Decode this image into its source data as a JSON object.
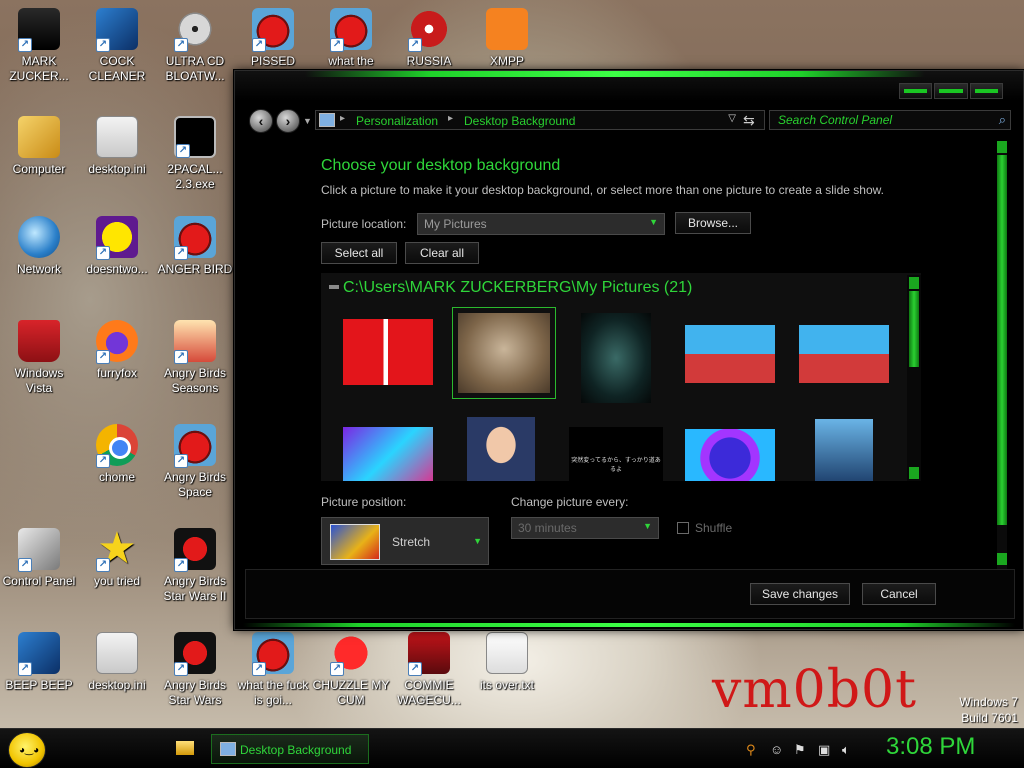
{
  "desktop": {
    "icons": [
      {
        "label": "MARK ZUCKER..."
      },
      {
        "label": "COCK CLEANER"
      },
      {
        "label": "ULTRA CD BLOATW..."
      },
      {
        "label": "PISSED"
      },
      {
        "label": "what the"
      },
      {
        "label": "RUSSIA"
      },
      {
        "label": "XMPP"
      },
      {
        "label": "Computer"
      },
      {
        "label": "desktop.ini"
      },
      {
        "label": "2PACAL... 2.3.exe"
      },
      {
        "label": "Network"
      },
      {
        "label": "doesntwo..."
      },
      {
        "label": "ANGER BIRD"
      },
      {
        "label": "Windows Vista"
      },
      {
        "label": "furryfox"
      },
      {
        "label": "Angry Birds Seasons"
      },
      {
        "label": "chome"
      },
      {
        "label": "Angry Birds Space"
      },
      {
        "label": "Control Panel"
      },
      {
        "label": "you tried"
      },
      {
        "label": "Angry Birds Star Wars II"
      },
      {
        "label": "BEEP BEEP"
      },
      {
        "label": "desktop.ini"
      },
      {
        "label": "Angry Birds Star Wars"
      },
      {
        "label": "what the fuck is goi..."
      },
      {
        "label": "CHUZZLE MY CUM"
      },
      {
        "label": "COMMIE WAGECU..."
      },
      {
        "label": "its over.txt"
      }
    ],
    "watermark": "vm0b0t",
    "os_name": "Windows 7",
    "os_build": "Build 7601"
  },
  "window": {
    "breadcrumb": [
      "Personalization",
      "Desktop Background"
    ],
    "search_placeholder": "Search Control Panel",
    "heading": "Choose your desktop background",
    "description": "Click a picture to make it your desktop background, or select more than one picture to create a slide show.",
    "picture_location_label": "Picture location:",
    "picture_location_value": "My Pictures",
    "browse_label": "Browse...",
    "select_all_label": "Select all",
    "clear_all_label": "Clear all",
    "gallery_title": "C:\\Users\\MARK ZUCKERBERG\\My Pictures (21)",
    "thumb_caption": "突然変ってるから、すっかり道あるよ",
    "picture_position_label": "Picture position:",
    "picture_position_value": "Stretch",
    "change_every_label": "Change picture every:",
    "change_every_value": "30 minutes",
    "shuffle_label": "Shuffle",
    "save_label": "Save changes",
    "cancel_label": "Cancel"
  },
  "taskbar": {
    "task_label": "Desktop Background",
    "clock": "3:08 PM"
  }
}
